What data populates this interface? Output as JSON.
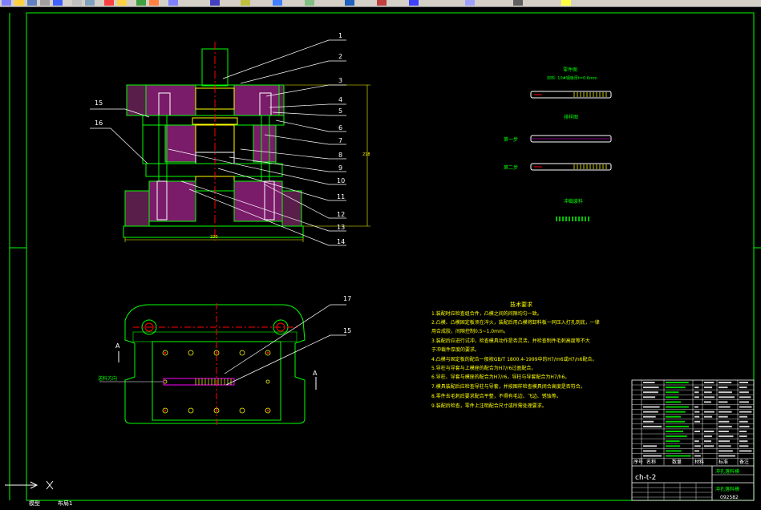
{
  "drawing": {
    "part_callouts": [
      "1",
      "2",
      "3",
      "4",
      "5",
      "6",
      "7",
      "8",
      "9",
      "10",
      "11",
      "12",
      "13",
      "14",
      "15",
      "16"
    ],
    "plan_callouts": [
      "17",
      "15"
    ],
    "section_marks": [
      "A",
      "A"
    ],
    "dim_height": "218",
    "dim_width": "220",
    "feed_label": "送料方向"
  },
  "strip": {
    "title": "零件图",
    "spec": "材料: 10#钢板厚t=0.6mm",
    "layout_title": "排样图",
    "step1": "第一步",
    "step2": "第二步",
    "scrap_title": "冲裁废料"
  },
  "notes": {
    "title": "技术要求",
    "lines": [
      "1.装配时应检查组合件，凸模之间的间隙均匀一致。",
      "2.凸模、凸模固定板须在淬火，装配后用凸模将卸料板一同压入打孔到底，一律",
      "   用合成胶，间隙控制0.5~1.0mm。",
      "3.装配后应进行试冲，检查模具动作是否灵活，并检查制件毛刺高度等不大",
      "   于冲裁件厚度的要求。",
      "4.凸模与固定板的配合一般按GB/T 1800.4-1999中的H7/m6或H7/n6配合。",
      "5.导柱与导套与上模座的配合为H7/r6过盈配合。",
      "6.导柱、导套与模座的配合为H7/r6，导柱与导套配合为H7/h6。",
      "7.模具装配后应检查导柱与导套，并按图样检查模具闭合高度是否符合。",
      "8.零件去毛刺后要求配合平整，不得有毛边、飞边、锈蚀等。",
      "9.装配后检查，零件上注明配合尺寸或所需处理要求。"
    ]
  },
  "title_block": {
    "drawing_no": "ch-t-2",
    "drawing_title": "冲孔落料模",
    "bottom_code": "092582",
    "header_cells": [
      "序号",
      "名称",
      "数量",
      "材料",
      "标准",
      "备注"
    ]
  },
  "bottom_tabs": [
    "模型",
    "布局1"
  ],
  "colors": {
    "background": "#000000",
    "green": "#00ff00",
    "white": "#ffffff",
    "yellow": "#ffff00",
    "magenta": "#ff00ff",
    "red": "#ff0000",
    "cyan": "#00ffff",
    "toolbar": "#d4d0c8"
  }
}
